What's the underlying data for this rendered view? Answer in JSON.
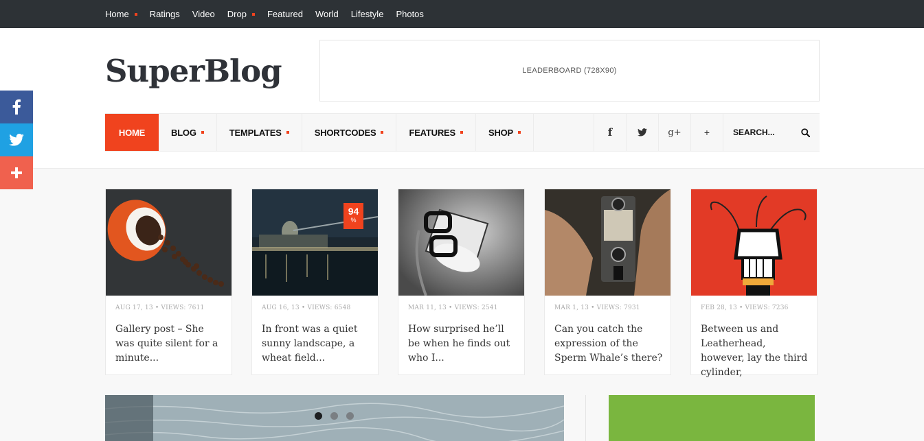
{
  "topbar": {
    "links": [
      {
        "label": "Home",
        "dot": true
      },
      {
        "label": "Ratings",
        "dot": false
      },
      {
        "label": "Video",
        "dot": false
      },
      {
        "label": "Drop",
        "dot": true
      },
      {
        "label": "Featured",
        "dot": false
      },
      {
        "label": "World",
        "dot": false
      },
      {
        "label": "Lifestyle",
        "dot": false
      },
      {
        "label": "Photos",
        "dot": false
      }
    ]
  },
  "header": {
    "logo": "SuperBlog",
    "leaderboard": "LEADERBOARD (728X90)"
  },
  "mainnav": {
    "items": [
      {
        "label": "HOME",
        "active": true,
        "dot": false
      },
      {
        "label": "BLOG",
        "active": false,
        "dot": true
      },
      {
        "label": "TEMPLATES",
        "active": false,
        "dot": true
      },
      {
        "label": "SHORTCODES",
        "active": false,
        "dot": true
      },
      {
        "label": "FEATURES",
        "active": false,
        "dot": true
      },
      {
        "label": "SHOP",
        "active": false,
        "dot": true
      }
    ],
    "social": [
      "f",
      "twitter-bird-icon",
      "g+",
      "+"
    ],
    "search_placeholder": "SEARCH..."
  },
  "share": [
    "facebook-icon",
    "twitter-icon",
    "plus-icon"
  ],
  "cards": [
    {
      "meta": "AUG 17, 13 • VIEWS: 7611",
      "title": "Gallery post – She was quite silent for a minute...",
      "image": "coffee-cup-beans"
    },
    {
      "meta": "AUG 16, 13 • VIEWS: 6548",
      "title": "In front was a quiet sunny landscape, a wheat field...",
      "image": "city-night-river",
      "badge": {
        "value": "94",
        "unit": "%"
      }
    },
    {
      "meta": "MAR 11, 13 • VIEWS: 2541",
      "title": "How surprised he’ll be when he finds out who I...",
      "image": "lamp-with-glasses"
    },
    {
      "meta": "MAR 1, 13 • VIEWS: 7931",
      "title": "Can you catch the expression of the Sperm Whale’s there?",
      "image": "vintage-camera"
    },
    {
      "meta": "FEB 28, 13 • VIEWS: 7236",
      "title": "Between us and Leatherhead, however, lay the third cylinder,",
      "image": "fist-guitar-poster"
    }
  ],
  "slider": {
    "pages": 3,
    "active": 0
  },
  "colors": {
    "accent": "#f0431e",
    "topbar": "#2d3236",
    "facebook": "#3b5a9a",
    "twitter": "#1fa1e3",
    "plus": "#f0614e",
    "green": "#7ab63f"
  }
}
